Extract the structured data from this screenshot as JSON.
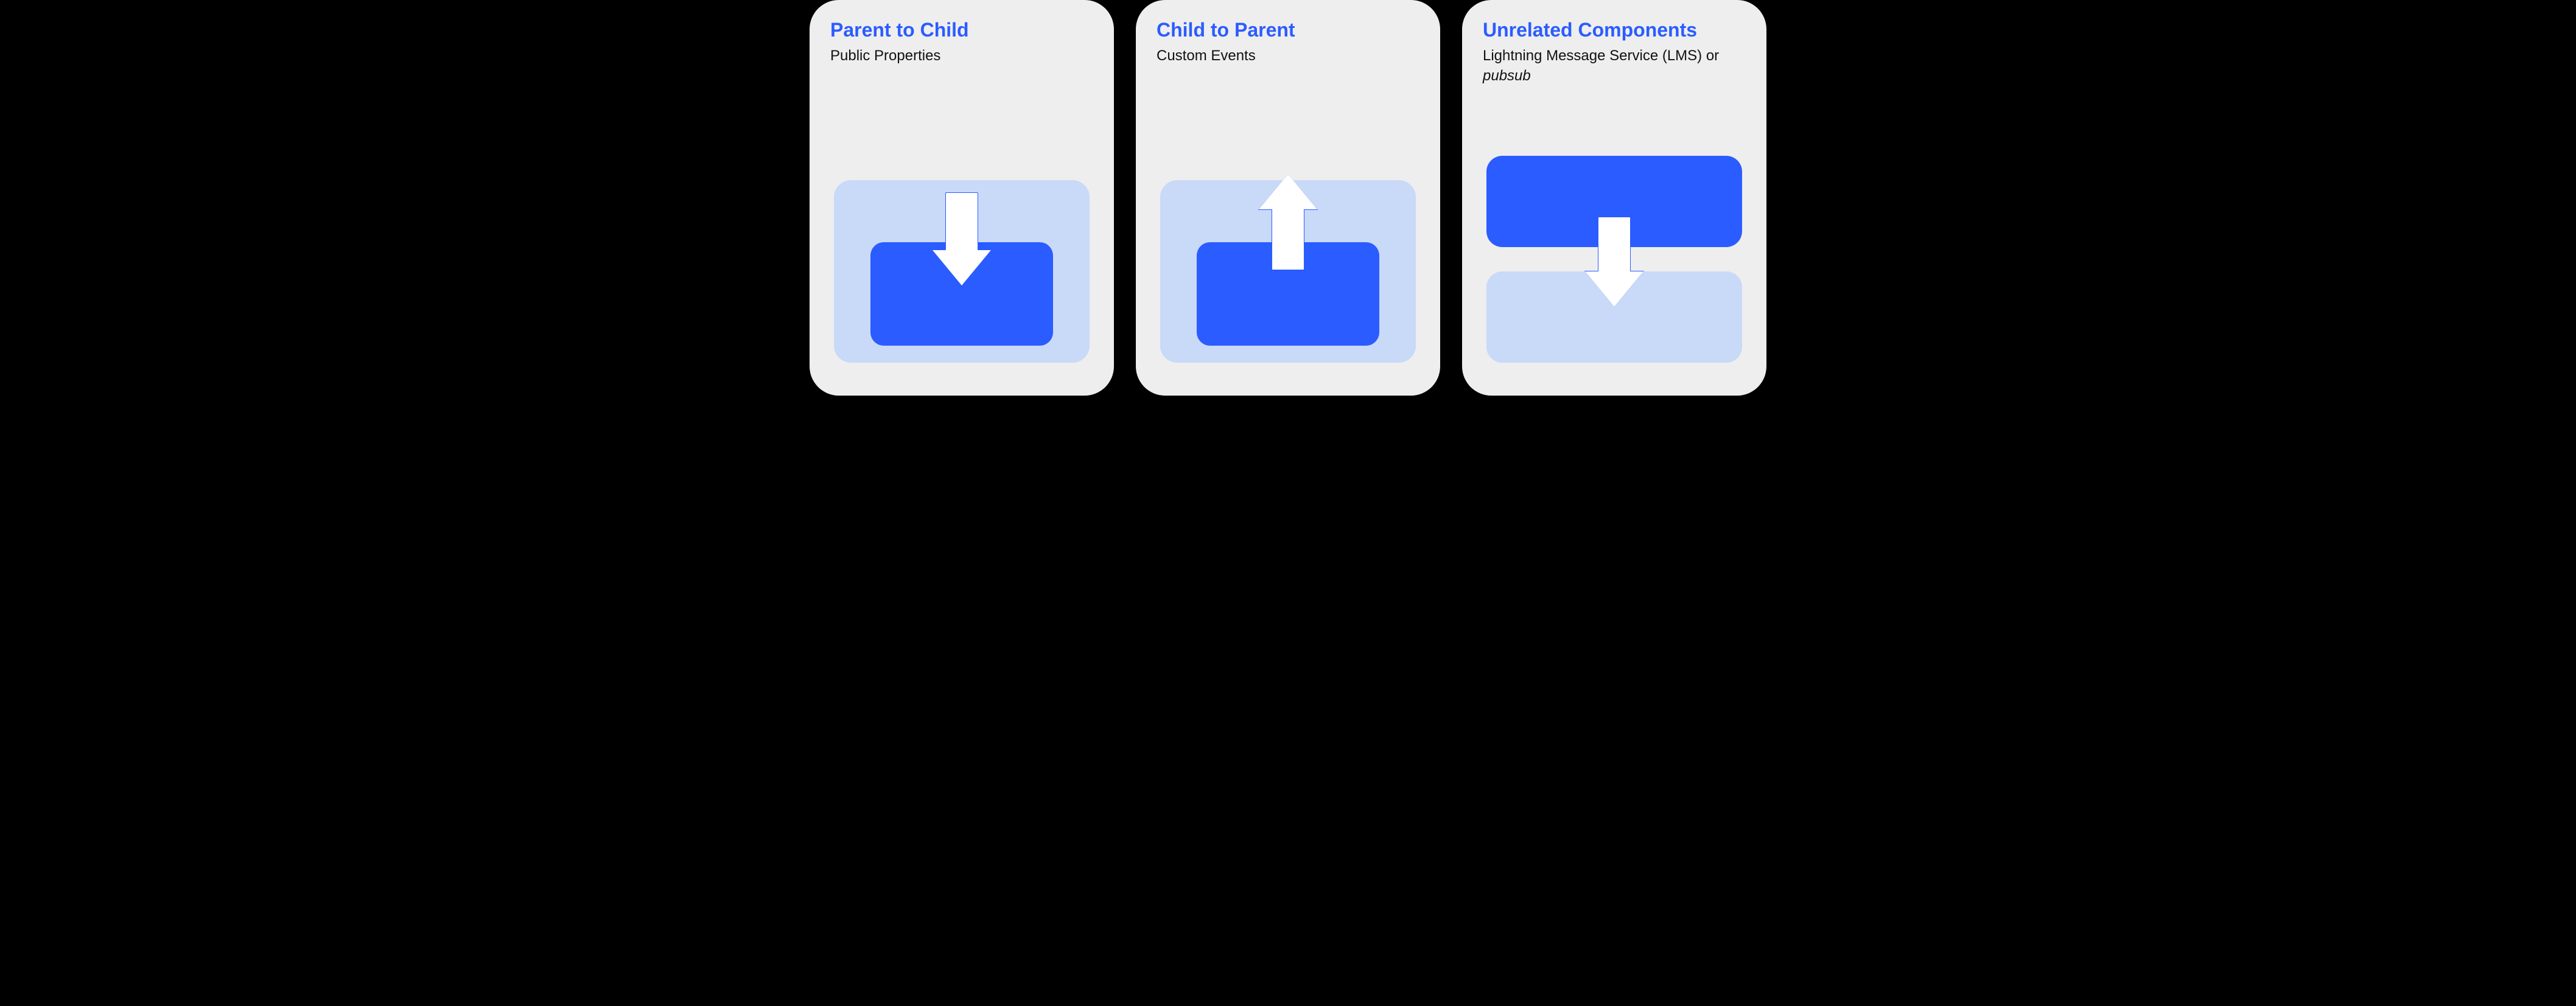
{
  "cards": [
    {
      "title": "Parent to Child",
      "subtitle": "Public Properties",
      "arrow": "down",
      "layout": "nested"
    },
    {
      "title": "Child to Parent",
      "subtitle": "Custom Events",
      "arrow": "up",
      "layout": "nested"
    },
    {
      "title": "Unrelated Components",
      "subtitle_html": "Lightning Message Service (LMS) or <span class=\"ital\">pubsub</span>",
      "arrow": "down",
      "layout": "separate"
    }
  ],
  "colors": {
    "accent": "#2b5cff",
    "light": "#c9d9f8",
    "card_bg": "#eeeeee",
    "page_bg": "#000000"
  }
}
